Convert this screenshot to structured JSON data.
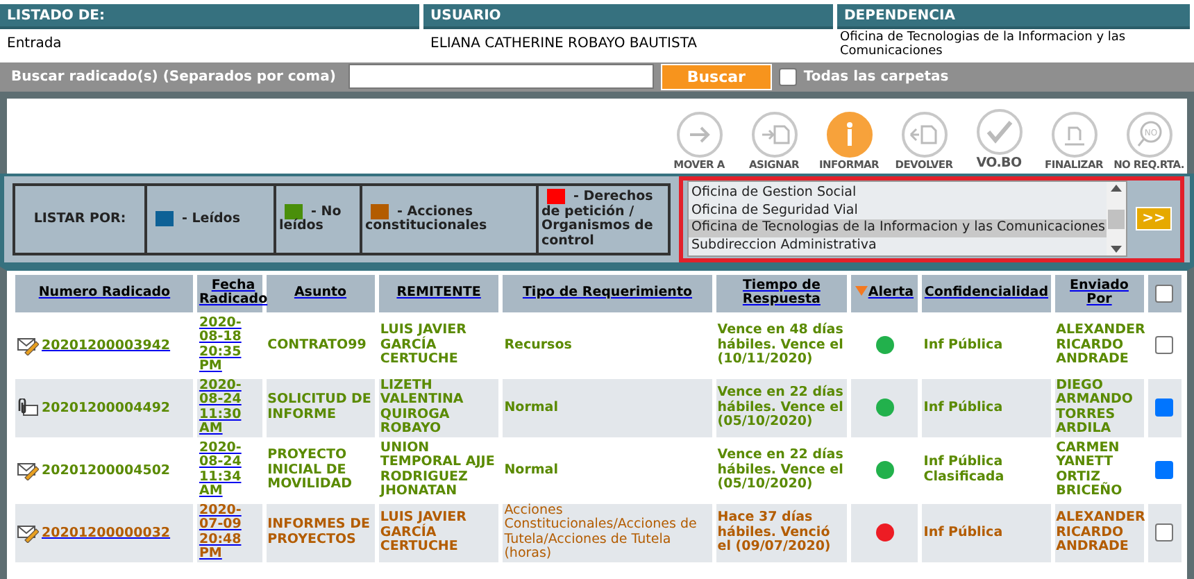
{
  "info": [
    {
      "label": "LISTADO DE:",
      "value": "Entrada"
    },
    {
      "label": "USUARIO",
      "value": "ELIANA CATHERINE ROBAYO BAUTISTA"
    },
    {
      "label": "DEPENDENCIA",
      "value": "Oficina de Tecnologias de la Informacion y las Comunicaciones"
    }
  ],
  "search": {
    "label": "Buscar radicado(s) (Separados por coma)",
    "button": "Buscar",
    "all_folders": {
      "label": "Todas las carpetas",
      "checked": false
    }
  },
  "actions": [
    {
      "label": "MOVER A",
      "kind": "arrow",
      "active": false,
      "bold": false
    },
    {
      "label": "ASIGNAR",
      "kind": "assign",
      "active": false,
      "bold": false
    },
    {
      "label": "INFORMAR",
      "kind": "info",
      "active": true,
      "bold": false
    },
    {
      "label": "DEVOLVER",
      "kind": "return",
      "active": false,
      "bold": false
    },
    {
      "label": "VO.BO",
      "kind": "check",
      "active": false,
      "bold": true
    },
    {
      "label": "FINALIZAR",
      "kind": "finish",
      "active": false,
      "bold": false
    },
    {
      "label": "NO REQ.RTA.",
      "kind": "noreply",
      "active": false,
      "bold": false,
      "badge": "NO"
    }
  ],
  "legend": {
    "title": "LISTAR POR:",
    "items": [
      {
        "label": "- Leídos",
        "color": "#0e6196"
      },
      {
        "label": "- No leídos",
        "color": "#4a8f0a"
      },
      {
        "label": "- Acciones constitucionales",
        "color": "#b35c00"
      },
      {
        "label": "- Derechos de petición / Organismos de control",
        "color": "#ff0000"
      }
    ]
  },
  "dependencies": {
    "items": [
      {
        "label": "Oficina de Gestion Social",
        "selected": false
      },
      {
        "label": "Oficina de Seguridad Vial",
        "selected": false
      },
      {
        "label": "Oficina de Tecnologias de la Informacion y las Comunicaciones",
        "selected": true
      },
      {
        "label": "Subdireccion Administrativa",
        "selected": false
      }
    ],
    "button": ">>"
  },
  "table": {
    "columns": [
      "Numero Radicado",
      "Fecha Radicado",
      "Asunto",
      "REMITENTE",
      "Tipo de Requerimiento",
      "Tiempo de Respuesta",
      "Alerta",
      "Confidencialidad",
      "Enviado Por"
    ],
    "select_all": false,
    "rows": [
      {
        "kind": "note",
        "color": "#5a8a00",
        "underlined": true,
        "number": "20201200003942",
        "date": "2020-08-18 20:35 PM",
        "subject": "CONTRATO99",
        "sender": "LUIS JAVIER GARCÍA CERTUCHE",
        "type": "Recursos",
        "response": "Vence en 48 días hábiles. Vence el (10/11/2020)",
        "alert": {
          "color": "#22b14c"
        },
        "confidentiality": "Inf Pública",
        "sent_by": "ALEXANDER RICARDO ANDRADE",
        "checked": false
      },
      {
        "kind": "attachment",
        "color": "#5a8a00",
        "underlined": false,
        "number": "20201200004492",
        "date": "2020-08-24 11:30 AM",
        "subject": "SOLICITUD DE INFORME",
        "sender": "LIZETH VALENTINA QUIROGA ROBAYO",
        "type": "Normal",
        "response": "Vence en 22 días hábiles. Vence el (05/10/2020)",
        "alert": {
          "color": "#22b14c"
        },
        "confidentiality": "Inf Pública",
        "sent_by": "DIEGO ARMANDO TORRES ARDILA",
        "checked": true
      },
      {
        "kind": "note",
        "color": "#5a8a00",
        "underlined": false,
        "number": "20201200004502",
        "date": "2020-08-24 11:34 AM",
        "subject": "PROYECTO INICIAL DE MOVILIDAD",
        "sender": "UNION TEMPORAL AJJE RODRIGUEZ JHONATAN",
        "type": "Normal",
        "response": "Vence en 22 días hábiles. Vence el (05/10/2020)",
        "alert": {
          "color": "#22b14c"
        },
        "confidentiality": "Inf Pública Clasificada",
        "sent_by": "CARMEN YANETT ORTIZ BRICEÑO",
        "checked": true
      },
      {
        "kind": "note",
        "color": "#b35c00",
        "underlined": true,
        "number": "20201200000032",
        "date": "2020-07-09 20:48 PM",
        "subject": "INFORMES DE PROYECTOS",
        "sender": "LUIS JAVIER GARCÍA CERTUCHE",
        "type": "Acciones Constitucionales/Acciones de Tutela/Acciones de Tutela (horas)",
        "response": "Hace 37 días hábiles. Venció el (09/07/2020)",
        "alert": {
          "color": "#ed1c24"
        },
        "confidentiality": "Inf Pública",
        "sent_by": "ALEXANDER RICARDO ANDRADE",
        "checked": false
      }
    ]
  }
}
